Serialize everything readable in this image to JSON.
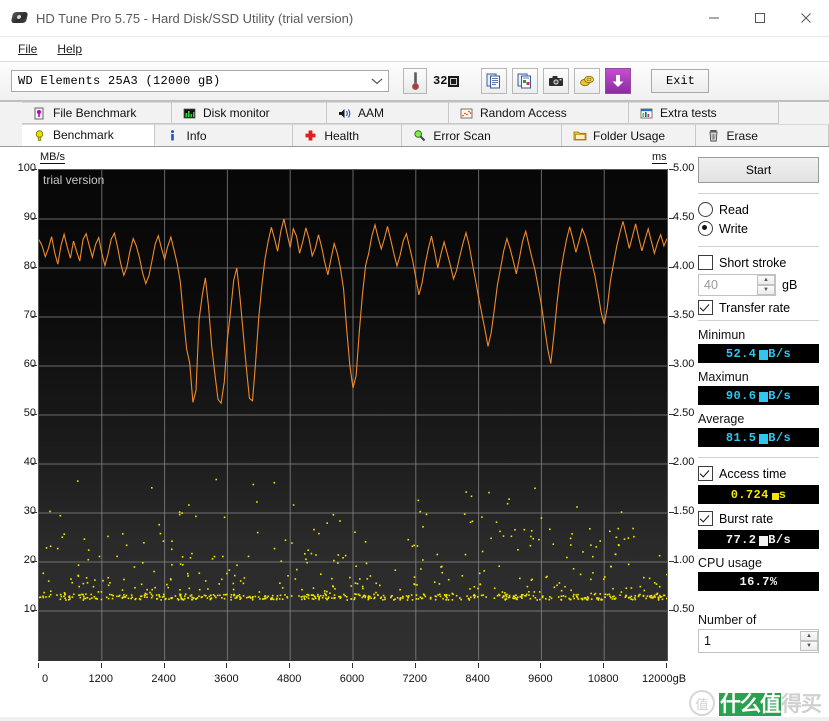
{
  "window": {
    "title": "HD Tune Pro 5.75 - Hard Disk/SSD Utility (trial version)",
    "app_icon": "hard-disk-icon",
    "minimize": "—",
    "maximize": "□",
    "close": "✕"
  },
  "menu": {
    "items": [
      {
        "label": "File",
        "mnemonic": "F"
      },
      {
        "label": "Help",
        "mnemonic": "H"
      }
    ]
  },
  "toolbar": {
    "drive_selected": "WD      Elements 25A3 (12000 gB)",
    "dropdown_arrow": "⌄",
    "temperature": "32",
    "temperature_unit": "°C",
    "buttons": [
      {
        "name": "copy-text-button",
        "icon": "copy-document-icon"
      },
      {
        "name": "copy-image-button",
        "icon": "copy-image-icon"
      },
      {
        "name": "screenshot-button",
        "icon": "camera-icon"
      },
      {
        "name": "save-button",
        "icon": "coins-icon"
      },
      {
        "name": "download-button",
        "icon": "download-arrow-icon"
      }
    ],
    "exit_label": "Exit"
  },
  "tabs": {
    "row1": [
      {
        "label": "File Benchmark",
        "icon": "file-benchmark-icon",
        "active": false
      },
      {
        "label": "Disk monitor",
        "icon": "bar-chart-icon",
        "active": false
      },
      {
        "label": "AAM",
        "icon": "speaker-icon",
        "active": false
      },
      {
        "label": "Random Access",
        "icon": "scatter-icon",
        "active": false
      },
      {
        "label": "Extra tests",
        "icon": "extra-tests-icon",
        "active": false
      }
    ],
    "row2": [
      {
        "label": "Benchmark",
        "icon": "lightbulb-icon",
        "active": true
      },
      {
        "label": "Info",
        "icon": "info-icon",
        "active": false
      },
      {
        "label": "Health",
        "icon": "red-cross-icon",
        "active": false
      },
      {
        "label": "Error Scan",
        "icon": "magnifier-icon",
        "active": false
      },
      {
        "label": "Folder Usage",
        "icon": "folder-icon",
        "active": false
      },
      {
        "label": "Erase",
        "icon": "trash-icon",
        "active": false
      }
    ]
  },
  "panel": {
    "start_label": "Start",
    "mode": {
      "read_label": "Read",
      "write_label": "Write",
      "selected": "Write"
    },
    "short_stroke": {
      "label": "Short stroke",
      "checked": false,
      "value": "40",
      "unit": "gB"
    },
    "transfer_rate": {
      "label": "Transfer rate",
      "checked": true,
      "minimum_label": "Minimun",
      "minimum_value": "52.4",
      "minimum_unit": "MB/s",
      "maximum_label": "Maximun",
      "maximum_value": "90.6",
      "maximum_unit": "MB/s",
      "average_label": "Average",
      "average_value": "81.5",
      "average_unit": "MB/s"
    },
    "access_time": {
      "label": "Access time",
      "checked": true,
      "value": "0.724",
      "unit": "ms"
    },
    "burst_rate": {
      "label": "Burst rate",
      "checked": true,
      "value": "77.2",
      "unit": "MB/s"
    },
    "cpu_usage": {
      "label": "CPU usage",
      "value": "16.7%"
    },
    "number_of": {
      "label": "Number of",
      "value": "1"
    }
  },
  "watermark": {
    "trial": "trial version",
    "brand_ring": "值",
    "brand_text_left": "什么值",
    "brand_text_right": "得买"
  },
  "chart_data": {
    "type": "line",
    "title": "",
    "xlabel": "gB",
    "ylabel": "MB/s",
    "y2label": "ms",
    "xlim": [
      0,
      12000
    ],
    "ylim": [
      0,
      100
    ],
    "y2lim": [
      0,
      5.0
    ],
    "grid": true,
    "xticks": [
      0,
      1200,
      2400,
      3600,
      4800,
      6000,
      7200,
      8400,
      9600,
      10800,
      12000
    ],
    "xticklabels": [
      "0",
      "1200",
      "2400",
      "3600",
      "4800",
      "6000",
      "7200",
      "8400",
      "9600",
      "10800",
      "12000gB"
    ],
    "yticks": [
      10,
      20,
      30,
      40,
      50,
      60,
      70,
      80,
      90,
      100
    ],
    "y2ticks": [
      0.5,
      1.0,
      1.5,
      2.0,
      2.5,
      3.0,
      3.5,
      4.0,
      4.5,
      5.0
    ],
    "series": [
      {
        "name": "Transfer rate",
        "type": "line",
        "color": "#f08a2a",
        "axis": "left",
        "unit": "MB/s",
        "x": [
          0,
          60,
          120,
          180,
          240,
          300,
          360,
          420,
          480,
          540,
          600,
          660,
          720,
          780,
          840,
          900,
          960,
          1020,
          1080,
          1140,
          1200,
          1260,
          1320,
          1380,
          1440,
          1500,
          1560,
          1620,
          1680,
          1740,
          1800,
          1860,
          1920,
          1980,
          2040,
          2100,
          2160,
          2220,
          2280,
          2340,
          2400,
          2460,
          2520,
          2580,
          2640,
          2700,
          2760,
          2820,
          2880,
          2940,
          3000,
          3060,
          3120,
          3180,
          3240,
          3300,
          3360,
          3420,
          3480,
          3540,
          3600,
          3660,
          3720,
          3780,
          3840,
          3900,
          3960,
          4020,
          4080,
          4140,
          4200,
          4260,
          4320,
          4380,
          4440,
          4500,
          4560,
          4620,
          4680,
          4740,
          4800,
          4860,
          4920,
          4980,
          5040,
          5100,
          5160,
          5220,
          5280,
          5340,
          5400,
          5460,
          5520,
          5580,
          5640,
          5700,
          5760,
          5820,
          5880,
          5940,
          6000,
          6060,
          6120,
          6180,
          6240,
          6300,
          6360,
          6420,
          6480,
          6540,
          6600,
          6660,
          6720,
          6780,
          6840,
          6900,
          6960,
          7020,
          7080,
          7140,
          7200,
          7260,
          7320,
          7380,
          7440,
          7500,
          7560,
          7620,
          7680,
          7740,
          7800,
          7860,
          7920,
          7980,
          8040,
          8100,
          8160,
          8220,
          8280,
          8340,
          8400,
          8460,
          8520,
          8580,
          8640,
          8700,
          8760,
          8820,
          8880,
          8940,
          9000,
          9060,
          9120,
          9180,
          9240,
          9300,
          9360,
          9420,
          9480,
          9540,
          9600,
          9660,
          9720,
          9780,
          9840,
          9900,
          9960,
          10020,
          10080,
          10140,
          10200,
          10260,
          10320,
          10380,
          10440,
          10500,
          10560,
          10620,
          10680,
          10740,
          10800,
          10860,
          10920,
          10980,
          11040,
          11100,
          11160,
          11220,
          11280,
          11340,
          11400,
          11460,
          11520,
          11580,
          11640,
          11700,
          11760,
          11820,
          11880,
          11940,
          12000
        ],
        "y": [
          85.8,
          84.5,
          82.3,
          84.0,
          86.4,
          83.1,
          80.8,
          84.6,
          86.9,
          84.2,
          82.0,
          85.5,
          83.3,
          81.4,
          85.8,
          87.0,
          84.6,
          82.2,
          84.8,
          86.2,
          83.0,
          80.5,
          82.9,
          85.9,
          87.1,
          84.3,
          81.0,
          78.5,
          80.2,
          83.6,
          86.0,
          84.5,
          82.1,
          79.0,
          76.8,
          78.4,
          81.5,
          84.9,
          86.6,
          84.0,
          81.8,
          84.4,
          86.3,
          83.7,
          80.9,
          77.2,
          70.2,
          63.5,
          60.6,
          52.6,
          55.0,
          69.5,
          74.5,
          78.0,
          72.0,
          64.0,
          58.5,
          53.2,
          52.4,
          56.8,
          65.5,
          71.0,
          77.5,
          80.0,
          74.0,
          67.0,
          60.0,
          53.4,
          52.9,
          61.0,
          70.0,
          76.5,
          82.0,
          85.5,
          88.3,
          86.0,
          83.4,
          87.5,
          90.0,
          87.0,
          84.2,
          88.0,
          86.5,
          83.0,
          85.4,
          88.2,
          86.0,
          82.5,
          84.0,
          86.8,
          84.3,
          81.2,
          78.6,
          81.9,
          85.0,
          83.0,
          80.0,
          75.6,
          67.5,
          60.0,
          55.5,
          58.0,
          67.0,
          74.5,
          80.5,
          83.0,
          86.5,
          88.8,
          86.2,
          83.9,
          86.0,
          88.5,
          85.8,
          83.0,
          80.4,
          82.6,
          85.5,
          87.0,
          84.3,
          81.5,
          78.0,
          74.5,
          77.0,
          80.8,
          84.0,
          86.5,
          83.4,
          80.0,
          82.8,
          85.3,
          83.0,
          80.6,
          77.8,
          79.5,
          82.4,
          85.0,
          87.2,
          84.6,
          81.0,
          77.5,
          74.0,
          70.8,
          67.5,
          64.0,
          66.8,
          71.5,
          76.5,
          80.0,
          83.5,
          86.0,
          84.0,
          81.6,
          78.8,
          82.0,
          85.5,
          87.5,
          84.8,
          82.0,
          79.5,
          76.0,
          72.5,
          68.0,
          63.5,
          60.5,
          66.5,
          73.0,
          78.5,
          82.5,
          85.8,
          88.4,
          86.0,
          83.2,
          85.6,
          88.0,
          86.4,
          84.0,
          81.2,
          78.5,
          75.0,
          71.0,
          68.5,
          72.0,
          77.5,
          81.0,
          84.5,
          87.2,
          89.5,
          86.8,
          84.0,
          86.5,
          89.0,
          86.2,
          83.5,
          85.8,
          88.0,
          85.5,
          83.0,
          85.2,
          86.8,
          84.5,
          86.0
        ]
      },
      {
        "name": "Access time",
        "type": "scatter",
        "color": "#f2e600",
        "axis": "right",
        "unit": "ms",
        "note": "Dense cluster of points near 0.55-0.90 ms along entire span, with scattered outliers up to ~1.85 ms",
        "cluster_baseline_ms": 0.62,
        "outlier_max_ms": 1.85,
        "point_count": 760
      }
    ]
  }
}
